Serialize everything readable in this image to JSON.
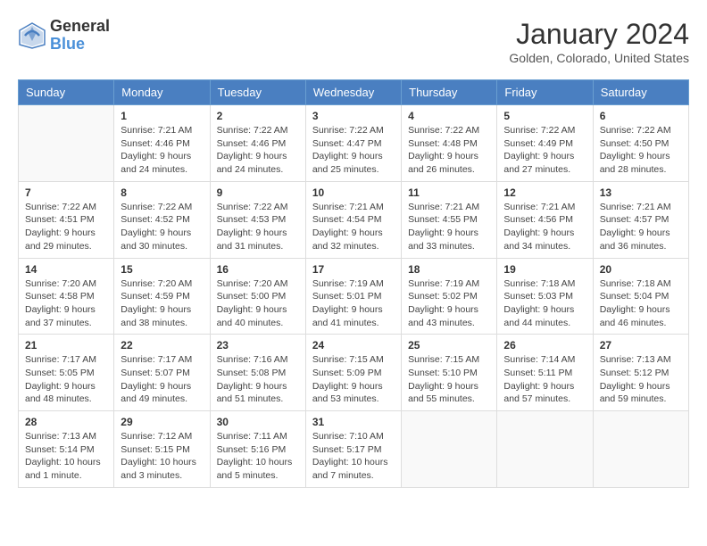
{
  "logo": {
    "general": "General",
    "blue": "Blue"
  },
  "title": "January 2024",
  "location": "Golden, Colorado, United States",
  "headers": [
    "Sunday",
    "Monday",
    "Tuesday",
    "Wednesday",
    "Thursday",
    "Friday",
    "Saturday"
  ],
  "weeks": [
    [
      {
        "day": "",
        "sunrise": "",
        "sunset": "",
        "daylight": ""
      },
      {
        "day": "1",
        "sunrise": "Sunrise: 7:21 AM",
        "sunset": "Sunset: 4:46 PM",
        "daylight": "Daylight: 9 hours and 24 minutes."
      },
      {
        "day": "2",
        "sunrise": "Sunrise: 7:22 AM",
        "sunset": "Sunset: 4:46 PM",
        "daylight": "Daylight: 9 hours and 24 minutes."
      },
      {
        "day": "3",
        "sunrise": "Sunrise: 7:22 AM",
        "sunset": "Sunset: 4:47 PM",
        "daylight": "Daylight: 9 hours and 25 minutes."
      },
      {
        "day": "4",
        "sunrise": "Sunrise: 7:22 AM",
        "sunset": "Sunset: 4:48 PM",
        "daylight": "Daylight: 9 hours and 26 minutes."
      },
      {
        "day": "5",
        "sunrise": "Sunrise: 7:22 AM",
        "sunset": "Sunset: 4:49 PM",
        "daylight": "Daylight: 9 hours and 27 minutes."
      },
      {
        "day": "6",
        "sunrise": "Sunrise: 7:22 AM",
        "sunset": "Sunset: 4:50 PM",
        "daylight": "Daylight: 9 hours and 28 minutes."
      }
    ],
    [
      {
        "day": "7",
        "sunrise": "Sunrise: 7:22 AM",
        "sunset": "Sunset: 4:51 PM",
        "daylight": "Daylight: 9 hours and 29 minutes."
      },
      {
        "day": "8",
        "sunrise": "Sunrise: 7:22 AM",
        "sunset": "Sunset: 4:52 PM",
        "daylight": "Daylight: 9 hours and 30 minutes."
      },
      {
        "day": "9",
        "sunrise": "Sunrise: 7:22 AM",
        "sunset": "Sunset: 4:53 PM",
        "daylight": "Daylight: 9 hours and 31 minutes."
      },
      {
        "day": "10",
        "sunrise": "Sunrise: 7:21 AM",
        "sunset": "Sunset: 4:54 PM",
        "daylight": "Daylight: 9 hours and 32 minutes."
      },
      {
        "day": "11",
        "sunrise": "Sunrise: 7:21 AM",
        "sunset": "Sunset: 4:55 PM",
        "daylight": "Daylight: 9 hours and 33 minutes."
      },
      {
        "day": "12",
        "sunrise": "Sunrise: 7:21 AM",
        "sunset": "Sunset: 4:56 PM",
        "daylight": "Daylight: 9 hours and 34 minutes."
      },
      {
        "day": "13",
        "sunrise": "Sunrise: 7:21 AM",
        "sunset": "Sunset: 4:57 PM",
        "daylight": "Daylight: 9 hours and 36 minutes."
      }
    ],
    [
      {
        "day": "14",
        "sunrise": "Sunrise: 7:20 AM",
        "sunset": "Sunset: 4:58 PM",
        "daylight": "Daylight: 9 hours and 37 minutes."
      },
      {
        "day": "15",
        "sunrise": "Sunrise: 7:20 AM",
        "sunset": "Sunset: 4:59 PM",
        "daylight": "Daylight: 9 hours and 38 minutes."
      },
      {
        "day": "16",
        "sunrise": "Sunrise: 7:20 AM",
        "sunset": "Sunset: 5:00 PM",
        "daylight": "Daylight: 9 hours and 40 minutes."
      },
      {
        "day": "17",
        "sunrise": "Sunrise: 7:19 AM",
        "sunset": "Sunset: 5:01 PM",
        "daylight": "Daylight: 9 hours and 41 minutes."
      },
      {
        "day": "18",
        "sunrise": "Sunrise: 7:19 AM",
        "sunset": "Sunset: 5:02 PM",
        "daylight": "Daylight: 9 hours and 43 minutes."
      },
      {
        "day": "19",
        "sunrise": "Sunrise: 7:18 AM",
        "sunset": "Sunset: 5:03 PM",
        "daylight": "Daylight: 9 hours and 44 minutes."
      },
      {
        "day": "20",
        "sunrise": "Sunrise: 7:18 AM",
        "sunset": "Sunset: 5:04 PM",
        "daylight": "Daylight: 9 hours and 46 minutes."
      }
    ],
    [
      {
        "day": "21",
        "sunrise": "Sunrise: 7:17 AM",
        "sunset": "Sunset: 5:05 PM",
        "daylight": "Daylight: 9 hours and 48 minutes."
      },
      {
        "day": "22",
        "sunrise": "Sunrise: 7:17 AM",
        "sunset": "Sunset: 5:07 PM",
        "daylight": "Daylight: 9 hours and 49 minutes."
      },
      {
        "day": "23",
        "sunrise": "Sunrise: 7:16 AM",
        "sunset": "Sunset: 5:08 PM",
        "daylight": "Daylight: 9 hours and 51 minutes."
      },
      {
        "day": "24",
        "sunrise": "Sunrise: 7:15 AM",
        "sunset": "Sunset: 5:09 PM",
        "daylight": "Daylight: 9 hours and 53 minutes."
      },
      {
        "day": "25",
        "sunrise": "Sunrise: 7:15 AM",
        "sunset": "Sunset: 5:10 PM",
        "daylight": "Daylight: 9 hours and 55 minutes."
      },
      {
        "day": "26",
        "sunrise": "Sunrise: 7:14 AM",
        "sunset": "Sunset: 5:11 PM",
        "daylight": "Daylight: 9 hours and 57 minutes."
      },
      {
        "day": "27",
        "sunrise": "Sunrise: 7:13 AM",
        "sunset": "Sunset: 5:12 PM",
        "daylight": "Daylight: 9 hours and 59 minutes."
      }
    ],
    [
      {
        "day": "28",
        "sunrise": "Sunrise: 7:13 AM",
        "sunset": "Sunset: 5:14 PM",
        "daylight": "Daylight: 10 hours and 1 minute."
      },
      {
        "day": "29",
        "sunrise": "Sunrise: 7:12 AM",
        "sunset": "Sunset: 5:15 PM",
        "daylight": "Daylight: 10 hours and 3 minutes."
      },
      {
        "day": "30",
        "sunrise": "Sunrise: 7:11 AM",
        "sunset": "Sunset: 5:16 PM",
        "daylight": "Daylight: 10 hours and 5 minutes."
      },
      {
        "day": "31",
        "sunrise": "Sunrise: 7:10 AM",
        "sunset": "Sunset: 5:17 PM",
        "daylight": "Daylight: 10 hours and 7 minutes."
      },
      {
        "day": "",
        "sunrise": "",
        "sunset": "",
        "daylight": ""
      },
      {
        "day": "",
        "sunrise": "",
        "sunset": "",
        "daylight": ""
      },
      {
        "day": "",
        "sunrise": "",
        "sunset": "",
        "daylight": ""
      }
    ]
  ]
}
